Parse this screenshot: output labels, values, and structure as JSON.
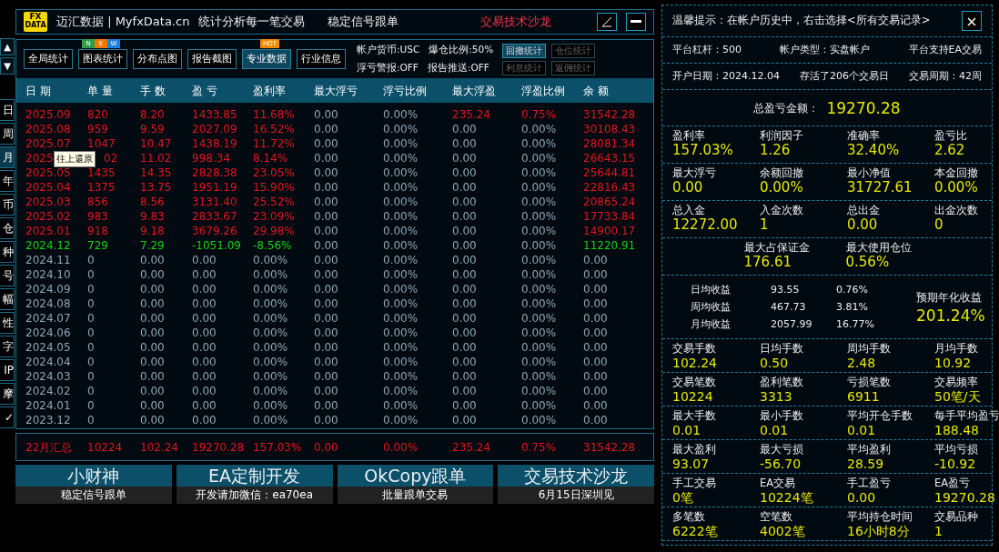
{
  "side_arrows": [
    "▲",
    "▼"
  ],
  "side_tabs": [
    {
      "label": "日",
      "selected": false
    },
    {
      "label": "周",
      "selected": false
    },
    {
      "label": "月",
      "selected": true
    },
    {
      "label": "年",
      "selected": false
    },
    {
      "label": "币",
      "selected": false
    },
    {
      "label": "仓",
      "selected": false
    },
    {
      "label": "种",
      "selected": false
    },
    {
      "label": "号",
      "selected": false
    },
    {
      "label": "幅",
      "selected": false
    },
    {
      "label": "性",
      "selected": false
    },
    {
      "label": "字",
      "selected": false
    },
    {
      "label": "IP",
      "selected": false
    },
    {
      "label": "摩",
      "selected": false
    },
    {
      "label": "✓",
      "selected": false
    }
  ],
  "title_bar": {
    "logo": [
      "FX",
      "DATA"
    ],
    "brand": "迈汇数据 | MyfxData.cn",
    "slogan": "统计分析每一笔交易",
    "center": "稳定信号跟单",
    "promo": "交易技术沙龙",
    "buttons": [
      {
        "kind": "edit"
      },
      {
        "kind": "minimize"
      }
    ]
  },
  "toolbar": {
    "buttons": [
      {
        "label": "全局统计",
        "selected": false
      },
      {
        "label": "图表统计",
        "selected": false,
        "badge": {
          "kind": "new",
          "letters": [
            "N",
            "E",
            "W"
          ]
        }
      },
      {
        "label": "分布点图",
        "selected": false
      },
      {
        "label": "报告截图",
        "selected": false
      },
      {
        "label": "专业数据",
        "selected": true,
        "badge": {
          "kind": "hot",
          "text": "HOT"
        }
      },
      {
        "label": "行业信息",
        "selected": false
      }
    ],
    "status": [
      [
        "帐户货币:USC",
        "爆仓比例:50%"
      ],
      [
        "浮亏警报:OFF",
        "报告推送:OFF"
      ]
    ],
    "small_buttons": [
      {
        "label": "回撤统计",
        "selected": true,
        "disabled": false
      },
      {
        "label": "仓位统计",
        "selected": false,
        "disabled": true
      },
      {
        "label": "利息统计",
        "selected": false,
        "disabled": true
      },
      {
        "label": "返佣统计",
        "selected": false,
        "disabled": true
      }
    ]
  },
  "table": {
    "columns": [
      "日 期",
      "单 量",
      "手 数",
      "盈 亏",
      "盈利率",
      "最大浮亏",
      "浮亏比例",
      "最大浮盈",
      "浮盈比例",
      "余 额"
    ],
    "rows": [
      {
        "cells": [
          {
            "text": "2025.09",
            "color": "#e8141e"
          },
          {
            "text": "820",
            "color": "#e8141e"
          },
          {
            "text": "8.20",
            "color": "#e8141e"
          },
          {
            "text": "1433.85",
            "color": "#e8141e"
          },
          {
            "text": "11.68%",
            "color": "#e8141e"
          },
          "0.00",
          "0.00%",
          {
            "text": "235.24",
            "color": "#e8141e"
          },
          {
            "text": "0.75%",
            "color": "#e8141e"
          },
          {
            "text": "31542.28",
            "color": "#e8141e"
          }
        ]
      },
      {
        "cells": [
          {
            "text": "2025.08",
            "color": "#e8141e"
          },
          {
            "text": "959",
            "color": "#e8141e"
          },
          {
            "text": "9.59",
            "color": "#e8141e"
          },
          {
            "text": "2027.09",
            "color": "#e8141e"
          },
          {
            "text": "16.52%",
            "color": "#e8141e"
          },
          "0.00",
          "0.00%",
          "0.00",
          "0.00%",
          {
            "text": "30108.43",
            "color": "#e8141e"
          }
        ]
      },
      {
        "cells": [
          {
            "text": "2025.07",
            "color": "#e8141e"
          },
          {
            "text": "1047",
            "color": "#e8141e"
          },
          {
            "text": "10.47",
            "color": "#e8141e"
          },
          {
            "text": "1438.19",
            "color": "#e8141e"
          },
          {
            "text": "11.72%",
            "color": "#e8141e"
          },
          "0.00",
          "0.00%",
          "0.00",
          "0.00%",
          {
            "text": "28081.34",
            "color": "#e8141e"
          }
        ]
      },
      {
        "cells": [
          {
            "text": "2025",
            "color": "#e8141e"
          },
          {
            "text": "02",
            "color": "#e8141e"
          },
          {
            "text": "11.02",
            "color": "#e8141e"
          },
          {
            "text": "998.34",
            "color": "#e8141e"
          },
          {
            "text": "8.14%",
            "color": "#e8141e"
          },
          "0.00",
          "0.00%",
          "0.00",
          "0.00%",
          {
            "text": "26643.15",
            "color": "#e8141e"
          }
        ]
      },
      {
        "cells": [
          {
            "text": "2025.05",
            "color": "#e8141e"
          },
          {
            "text": "1435",
            "color": "#e8141e"
          },
          {
            "text": "14.35",
            "color": "#e8141e"
          },
          {
            "text": "2828.38",
            "color": "#e8141e"
          },
          {
            "text": "23.05%",
            "color": "#e8141e"
          },
          "0.00",
          "0.00%",
          "0.00",
          "0.00%",
          {
            "text": "25644.81",
            "color": "#e8141e"
          }
        ]
      },
      {
        "cells": [
          {
            "text": "2025.04",
            "color": "#e8141e"
          },
          {
            "text": "1375",
            "color": "#e8141e"
          },
          {
            "text": "13.75",
            "color": "#e8141e"
          },
          {
            "text": "1951.19",
            "color": "#e8141e"
          },
          {
            "text": "15.90%",
            "color": "#e8141e"
          },
          "0.00",
          "0.00%",
          "0.00",
          "0.00%",
          {
            "text": "22816.43",
            "color": "#e8141e"
          }
        ]
      },
      {
        "cells": [
          {
            "text": "2025.03",
            "color": "#e8141e"
          },
          {
            "text": "856",
            "color": "#e8141e"
          },
          {
            "text": "8.56",
            "color": "#e8141e"
          },
          {
            "text": "3131.40",
            "color": "#e8141e"
          },
          {
            "text": "25.52%",
            "color": "#e8141e"
          },
          "0.00",
          "0.00%",
          "0.00",
          "0.00%",
          {
            "text": "20865.24",
            "color": "#e8141e"
          }
        ]
      },
      {
        "cells": [
          {
            "text": "2025.02",
            "color": "#e8141e"
          },
          {
            "text": "983",
            "color": "#e8141e"
          },
          {
            "text": "9.83",
            "color": "#e8141e"
          },
          {
            "text": "2833.67",
            "color": "#e8141e"
          },
          {
            "text": "23.09%",
            "color": "#e8141e"
          },
          "0.00",
          "0.00%",
          "0.00",
          "0.00%",
          {
            "text": "17733.84",
            "color": "#e8141e"
          }
        ]
      },
      {
        "cells": [
          {
            "text": "2025.01",
            "color": "#e8141e"
          },
          {
            "text": "918",
            "color": "#e8141e"
          },
          {
            "text": "9.18",
            "color": "#e8141e"
          },
          {
            "text": "3679.26",
            "color": "#e8141e"
          },
          {
            "text": "29.98%",
            "color": "#e8141e"
          },
          "0.00",
          "0.00%",
          "0.00",
          "0.00%",
          {
            "text": "14900.17",
            "color": "#e8141e"
          }
        ]
      },
      {
        "cells": [
          {
            "text": "2024.12",
            "color": "#13d113"
          },
          {
            "text": "729",
            "color": "#13d113"
          },
          {
            "text": "7.29",
            "color": "#13d113"
          },
          {
            "text": "-1051.09",
            "color": "#13d113"
          },
          {
            "text": "-8.56%",
            "color": "#13d113"
          },
          "0.00",
          "0.00%",
          "0.00",
          "0.00%",
          {
            "text": "11220.91",
            "color": "#13d113"
          }
        ]
      },
      {
        "cells": [
          "2024.11",
          "0",
          "0.00",
          "0.00",
          "0.00%",
          "0.00",
          "0.00%",
          "0.00",
          "0.00%",
          "0.00"
        ]
      },
      {
        "cells": [
          "2024.10",
          "0",
          "0.00",
          "0.00",
          "0.00%",
          "0.00",
          "0.00%",
          "0.00",
          "0.00%",
          "0.00"
        ]
      },
      {
        "cells": [
          "2024.09",
          "0",
          "0.00",
          "0.00",
          "0.00%",
          "0.00",
          "0.00%",
          "0.00",
          "0.00%",
          "0.00"
        ]
      },
      {
        "cells": [
          "2024.08",
          "0",
          "0.00",
          "0.00",
          "0.00%",
          "0.00",
          "0.00%",
          "0.00",
          "0.00%",
          "0.00"
        ]
      },
      {
        "cells": [
          "2024.07",
          "0",
          "0.00",
          "0.00",
          "0.00%",
          "0.00",
          "0.00%",
          "0.00",
          "0.00%",
          "0.00"
        ]
      },
      {
        "cells": [
          "2024.06",
          "0",
          "0.00",
          "0.00",
          "0.00%",
          "0.00",
          "0.00%",
          "0.00",
          "0.00%",
          "0.00"
        ]
      },
      {
        "cells": [
          "2024.05",
          "0",
          "0.00",
          "0.00",
          "0.00%",
          "0.00",
          "0.00%",
          "0.00",
          "0.00%",
          "0.00"
        ]
      },
      {
        "cells": [
          "2024.04",
          "0",
          "0.00",
          "0.00",
          "0.00%",
          "0.00",
          "0.00%",
          "0.00",
          "0.00%",
          "0.00"
        ]
      },
      {
        "cells": [
          "2024.03",
          "0",
          "0.00",
          "0.00",
          "0.00%",
          "0.00",
          "0.00%",
          "0.00",
          "0.00%",
          "0.00"
        ]
      },
      {
        "cells": [
          "2024.02",
          "0",
          "0.00",
          "0.00",
          "0.00%",
          "0.00",
          "0.00%",
          "0.00",
          "0.00%",
          "0.00"
        ]
      },
      {
        "cells": [
          "2024.01",
          "0",
          "0.00",
          "0.00",
          "0.00%",
          "0.00",
          "0.00%",
          "0.00",
          "0.00%",
          "0.00"
        ]
      },
      {
        "cells": [
          "2023.12",
          "0",
          "0.00",
          "0.00",
          "0.00%",
          "0.00",
          "0.00%",
          "0.00",
          "0.00%",
          "0.00"
        ]
      }
    ],
    "tooltip": "往上還原",
    "summary": [
      "22月汇总",
      "10224",
      "102.24",
      "19270.28",
      "157.03%",
      "0.00",
      "0.00%",
      "235.24",
      "0.75%",
      "31542.28"
    ]
  },
  "tiles": [
    {
      "title": "小财神",
      "subtitle": "稳定信号跟单"
    },
    {
      "title": "EA定制开发",
      "subtitle": "开发请加微信：ea70ea"
    },
    {
      "title": "OkCopy跟单",
      "subtitle": "批量跟单交易"
    },
    {
      "title": "交易技术沙龙",
      "subtitle": "6月15日深圳见"
    }
  ],
  "panel": {
    "notice": "温馨提示：在帐户历史中，右击选择<所有交易记录>",
    "info_rows": [
      [
        "平台杠杆：500",
        "帐户类型：实盘帐户",
        "平台支持EA交易"
      ],
      [
        "开户日期：2024.12.04",
        "存活了206个交易日",
        "交易周期：42周"
      ]
    ],
    "total": {
      "label": "总盈亏金额：",
      "value": "19270.28"
    },
    "sections": [
      {
        "kind": "stats",
        "items": [
          {
            "label": "盈利率",
            "value": "157.03%"
          },
          {
            "label": "利润因子",
            "value": "1.26"
          },
          {
            "label": "准确率",
            "value": "32.40%"
          },
          {
            "label": "盈亏比",
            "value": "2.62"
          }
        ]
      },
      {
        "kind": "stats",
        "items": [
          {
            "label": "最大浮亏",
            "value": "0.00"
          },
          {
            "label": "余额回撤",
            "value": "0.00%"
          },
          {
            "label": "最小净值",
            "value": "31727.61"
          },
          {
            "label": "本金回撤",
            "value": "0.00%"
          }
        ]
      },
      {
        "kind": "stats",
        "items": [
          {
            "label": "总入金",
            "value": "12272.00"
          },
          {
            "label": "入金次数",
            "value": "1"
          },
          {
            "label": "总出金",
            "value": "0.00"
          },
          {
            "label": "出金次数",
            "value": "0"
          }
        ]
      },
      {
        "kind": "pair",
        "items": [
          {
            "label": "最大占保证金",
            "value": "176.61"
          },
          {
            "label": "最大使用仓位",
            "value": "0.56%"
          }
        ]
      },
      {
        "kind": "averages",
        "rows": [
          {
            "label": "日均收益",
            "value": "93.55",
            "percent": "0.76%"
          },
          {
            "label": "周均收益",
            "value": "467.73",
            "percent": "3.81%"
          },
          {
            "label": "月均收益",
            "value": "2057.99",
            "percent": "16.77%"
          }
        ],
        "forecast": {
          "label": "预期年化收益",
          "value": "201.24%"
        }
      },
      {
        "kind": "stats",
        "items": [
          {
            "label": "交易手数",
            "value": "102.24"
          },
          {
            "label": "日均手数",
            "value": "0.50"
          },
          {
            "label": "周均手数",
            "value": "2.48"
          },
          {
            "label": "月均手数",
            "value": "10.92"
          }
        ]
      },
      {
        "kind": "stats",
        "items": [
          {
            "label": "交易笔数",
            "value": "10224"
          },
          {
            "label": "盈利笔数",
            "value": "3313"
          },
          {
            "label": "亏损笔数",
            "value": "6911"
          },
          {
            "label": "交易频率",
            "value": "50笔/天"
          }
        ]
      },
      {
        "kind": "stats",
        "items": [
          {
            "label": "最大手数",
            "value": "0.01"
          },
          {
            "label": "最小手数",
            "value": "0.01"
          },
          {
            "label": "平均开仓手数",
            "value": "0.01"
          },
          {
            "label": "每手平均盈亏",
            "value": "188.48"
          }
        ]
      },
      {
        "kind": "stats",
        "items": [
          {
            "label": "最大盈利",
            "value": "93.07"
          },
          {
            "label": "最大亏损",
            "value": "-56.70"
          },
          {
            "label": "平均盈利",
            "value": "28.59"
          },
          {
            "label": "平均亏损",
            "value": "-10.92"
          }
        ]
      },
      {
        "kind": "stats",
        "items": [
          {
            "label": "手工交易",
            "value": "0笔"
          },
          {
            "label": "EA交易",
            "value": "10224笔"
          },
          {
            "label": "手工盈亏",
            "value": "0.00"
          },
          {
            "label": "EA盈亏",
            "value": "19270.28"
          }
        ]
      },
      {
        "kind": "stats",
        "items": [
          {
            "label": "多笔数",
            "value": "6222笔"
          },
          {
            "label": "空笔数",
            "value": "4002笔"
          },
          {
            "label": "平均持仓时间",
            "value": "16小时8分"
          },
          {
            "label": "交易品种",
            "value": "1"
          }
        ]
      }
    ]
  }
}
